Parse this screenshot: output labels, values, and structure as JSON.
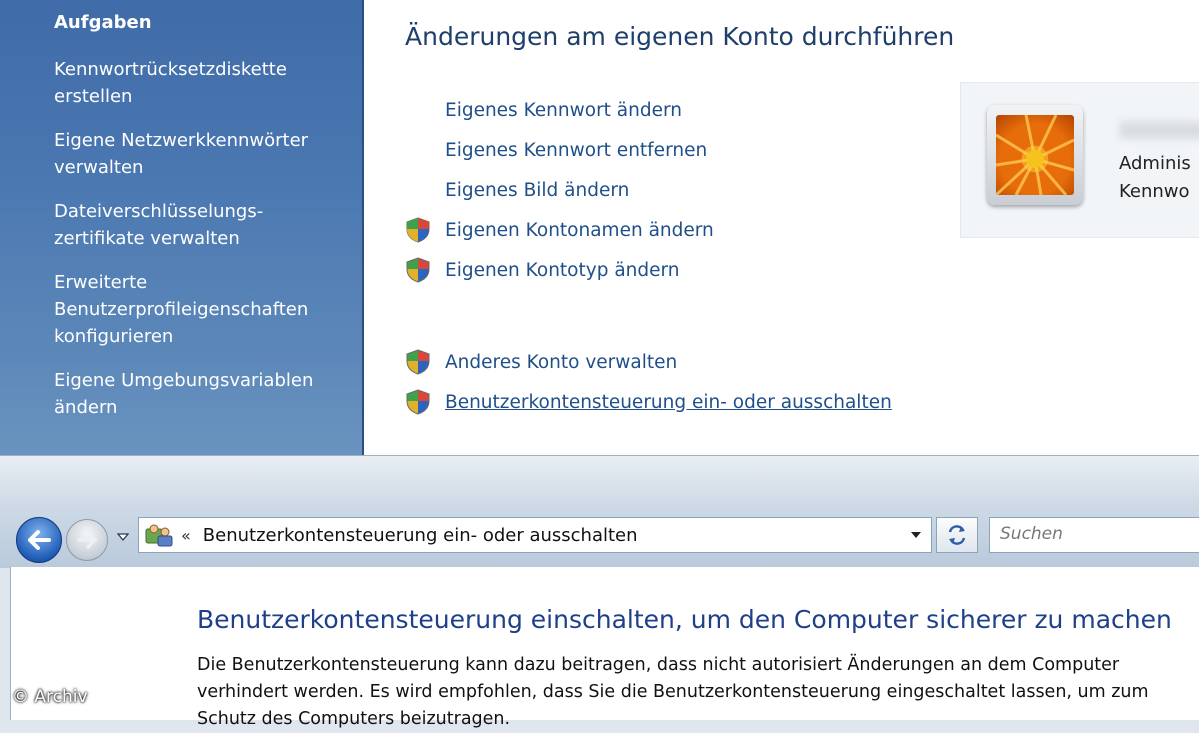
{
  "sidebar": {
    "heading": "Aufgaben",
    "items": [
      {
        "label": "Kennwortrücksetzdiskette\nerstellen"
      },
      {
        "label": "Eigene Netzwerkkennwörter\nverwalten"
      },
      {
        "label": "Dateiverschlüsselungs-\nzertifikate verwalten"
      },
      {
        "label": "Erweiterte\nBenutzerprofileigenschaften\nkonfigurieren"
      },
      {
        "label": "Eigene Umgebungsvariablen\nändern"
      }
    ]
  },
  "main": {
    "title": "Änderungen am eigenen Konto durchführen",
    "tasks": [
      {
        "label": "Eigenes Kennwort ändern",
        "shield": false
      },
      {
        "label": "Eigenes Kennwort entfernen",
        "shield": false
      },
      {
        "label": "Eigenes Bild ändern",
        "shield": false
      },
      {
        "label": "Eigenen Kontonamen ändern",
        "shield": true
      },
      {
        "label": "Eigenen Kontotyp ändern",
        "shield": true
      },
      {
        "label": "Anderes Konto verwalten",
        "shield": true
      },
      {
        "label": "Benutzerkontensteuerung ein- oder ausschalten",
        "shield": true
      }
    ]
  },
  "account": {
    "type_partial": "Adminis",
    "password_partial": "Kennwo"
  },
  "uac_window": {
    "breadcrumb_chevron": "«",
    "address": "Benutzerkontensteuerung ein- oder ausschalten",
    "search_placeholder": "Suchen",
    "title": "Benutzerkontensteuerung einschalten, um den Computer sicherer zu machen",
    "description": "Die Benutzerkontensteuerung kann dazu beitragen, dass nicht autorisiert Änderungen an dem Computer verhindert werden. Es wird empfohlen, dass Sie die Benutzerkontensteuerung eingeschaltet lassen, um zum Schutz des Computers beizutragen."
  },
  "watermark": "© Archiv",
  "colors": {
    "sidebar": "#4b78b1",
    "link": "#1f4f8a",
    "title": "#1e3f6b"
  }
}
